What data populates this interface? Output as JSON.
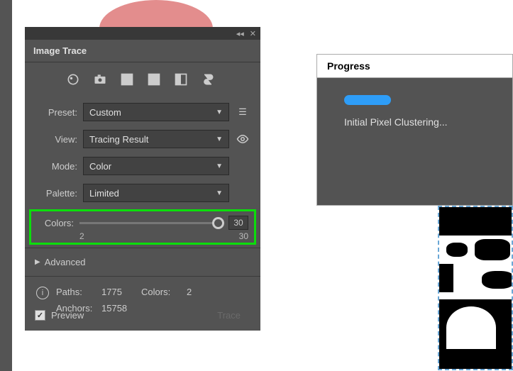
{
  "panel": {
    "title": "Image Trace",
    "preset": {
      "label": "Preset:",
      "value": "Custom"
    },
    "view": {
      "label": "View:",
      "value": "Tracing Result"
    },
    "mode": {
      "label": "Mode:",
      "value": "Color"
    },
    "palette": {
      "label": "Palette:",
      "value": "Limited"
    },
    "colors": {
      "label": "Colors:",
      "value": "30",
      "min": "2",
      "max": "30"
    },
    "advanced": "Advanced",
    "info": {
      "pathsLabel": "Paths:",
      "pathsVal": "1775",
      "colorsLabel": "Colors:",
      "colorsVal": "2",
      "anchorsLabel": "Anchors:",
      "anchorsVal": "15758"
    },
    "preview": "Preview",
    "traceBtn": "Trace"
  },
  "progress": {
    "title": "Progress",
    "status": "Initial Pixel Clustering..."
  }
}
